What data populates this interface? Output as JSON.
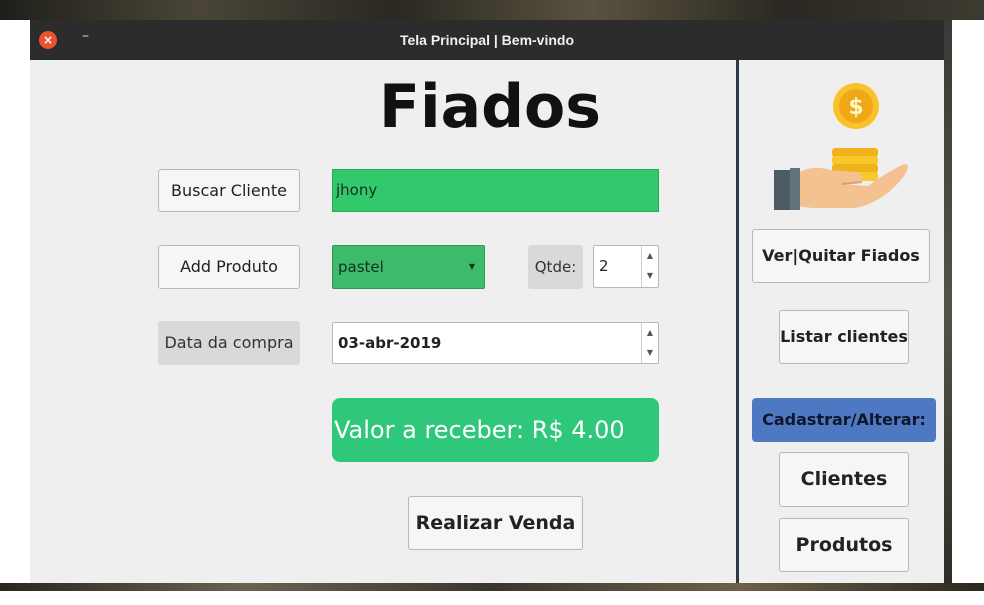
{
  "window": {
    "title": "Tela Principal | Bem-vindo"
  },
  "main": {
    "heading": "Fiados",
    "buscar_cliente_label": "Buscar Cliente",
    "cliente_value": "jhony",
    "add_produto_label": "Add Produto",
    "produto_selected": "pastel",
    "qtde_label": "Qtde:",
    "qtde_value": "2",
    "data_label": "Data da compra",
    "data_value": "03-abr-2019",
    "valor_text": "Valor a receber: R$ 4.00",
    "realizar_label": "Realizar Venda"
  },
  "side": {
    "ver_quitar_label": "Ver|Quitar Fiados",
    "listar_clientes_label": "Listar clientes",
    "cadastrar_label": "Cadastrar/Alterar:",
    "clientes_label": "Clientes",
    "produtos_label": "Produtos"
  },
  "colors": {
    "green_field": "#31c96c",
    "valor_bg": "#2fc77a",
    "accent_blue": "#4e78c2",
    "titlebar": "#2c2c2c"
  },
  "icons": {
    "logo": "hand-coins-icon",
    "close": "close-icon",
    "minimize": "minimize-icon",
    "combo_arrow": "dropdown-arrow-icon"
  }
}
